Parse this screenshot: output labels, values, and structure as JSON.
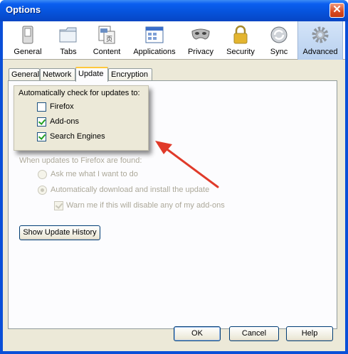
{
  "window": {
    "title": "Options",
    "close_label": "✕"
  },
  "panes": [
    {
      "id": "general",
      "label": "General",
      "icon": "general-switch-icon"
    },
    {
      "id": "tabs",
      "label": "Tabs",
      "icon": "tabs-folder-icon"
    },
    {
      "id": "content",
      "label": "Content",
      "icon": "content-page-icon"
    },
    {
      "id": "applications",
      "label": "Applications",
      "icon": "applications-window-icon"
    },
    {
      "id": "privacy",
      "label": "Privacy",
      "icon": "privacy-mask-icon"
    },
    {
      "id": "security",
      "label": "Security",
      "icon": "security-lock-icon"
    },
    {
      "id": "sync",
      "label": "Sync",
      "icon": "sync-arrows-icon"
    },
    {
      "id": "advanced",
      "label": "Advanced",
      "icon": "advanced-gear-icon"
    }
  ],
  "selected_pane": "Advanced",
  "tabs": [
    {
      "label": "General"
    },
    {
      "label": "Network"
    },
    {
      "label": "Update"
    },
    {
      "label": "Encryption"
    }
  ],
  "active_tab": "Update",
  "auto_check": {
    "heading": "Automatically check for updates to:",
    "items": [
      {
        "label": "Firefox",
        "checked": false
      },
      {
        "label": "Add-ons",
        "checked": true
      },
      {
        "label": "Search Engines",
        "checked": true
      }
    ]
  },
  "when_found": {
    "heading": "When updates to Firefox are found:",
    "options": [
      {
        "label": "Ask me what I want to do",
        "selected": false
      },
      {
        "label": "Automatically download and install the update",
        "selected": true
      }
    ],
    "warn": {
      "label": "Warn me if this will disable any of my add-ons",
      "checked": true
    }
  },
  "history_button": "Show Update History",
  "footer": {
    "ok": "OK",
    "cancel": "Cancel",
    "help": "Help"
  },
  "colors": {
    "titlebar": "#0653dc",
    "dialog": "#ece9d8",
    "annotation_arrow": "#e03a2a"
  }
}
